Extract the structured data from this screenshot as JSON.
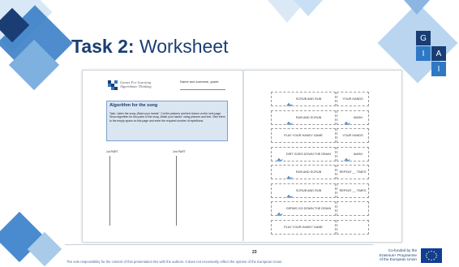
{
  "slide": {
    "title_bold": "Task 2:",
    "title_rest": " Worksheet",
    "page_number": "23",
    "disclaimer": "The sole responsibility for the content of this presentation lies with the authors. It does not necessarily reflect the opinion of the European Union.",
    "eu_line1": "Co-funded by the",
    "eu_line2": "Erasmus+ Programme",
    "eu_line3": "of the European Union",
    "logo_letters": [
      "G",
      "I",
      "A",
      "I"
    ]
  },
  "worksheet": {
    "brand_line1": "Games For Learning",
    "brand_line2": "Algorithmic Thinking",
    "name_label": "Name and surname, grade",
    "algo_title": "Algorithm for the song",
    "algo_text": "Task: Listen the song „Wash your hands\". Cut the pictures and text shown on the next page. Show algorithm for two parts of the song „Wash your hands\" using pictures and text. Glue them to the empty space on this page and enter the required number of repetitions.",
    "part1": "1st PART",
    "part2": "2nd PART",
    "cards": [
      [
        "SCRUB AND RUB",
        "YOUR HANDS"
      ],
      [
        "RUB AND SCRUB",
        "WASH"
      ],
      [
        "PLAY YOUR HANDY GAME",
        "YOUR HANDS"
      ],
      [
        "DIRT GOES DOWN THE DRAIN",
        "WASH"
      ],
      [
        "RUB AND SCRUB",
        "REPEAT __ TIMES"
      ],
      [
        "SCRUB AND RUB",
        "REPEAT __ TIMES"
      ],
      [
        "GERMS GO DOWN THE DRAIN",
        ""
      ],
      [
        "PLAY YOUR HANDY GAME",
        ""
      ]
    ]
  },
  "colors": {
    "dark_blue": "#1a3e73",
    "light_blue": "#a9cbe9",
    "mid_blue": "#2f78c4"
  }
}
